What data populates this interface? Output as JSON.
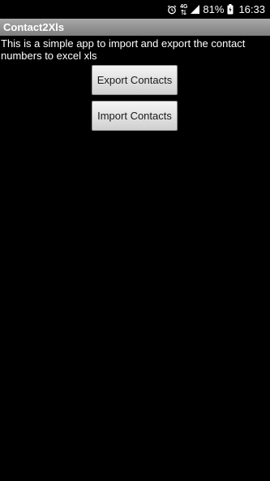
{
  "status_bar": {
    "alarm_icon": "alarm-clock-icon",
    "network_label": "4G",
    "signal_icon": "signal-bars-icon",
    "battery_percent": "81%",
    "battery_icon": "battery-charging-icon",
    "time": "16:33"
  },
  "app": {
    "title": "Contact2Xls"
  },
  "main": {
    "description": "This is a simple app to import and export the contact numbers to excel xls",
    "export_label": "Export Contacts",
    "import_label": "Import Contacts"
  },
  "colors": {
    "background": "#000000",
    "title_bar": "#8f8f8f",
    "text": "#ffffff",
    "button_face": "#e2e2e2"
  }
}
